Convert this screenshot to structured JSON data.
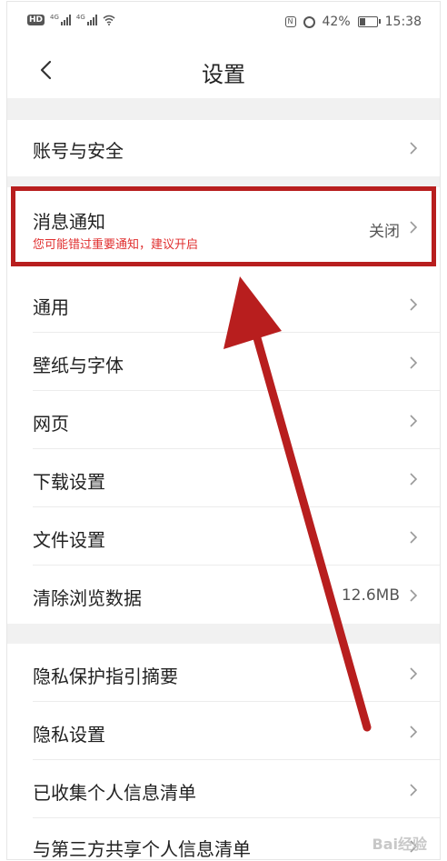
{
  "status_bar": {
    "network_badge": "HD",
    "sim1_tag": "4G",
    "sim2_tag": "4G",
    "battery_percent": 42,
    "battery_text": "42%",
    "time": "15:38",
    "icons": [
      "signal-icon",
      "wifi-icon",
      "nfc-icon",
      "alarm-icon",
      "battery-icon"
    ]
  },
  "header": {
    "back_icon": "chevron-left-icon",
    "title": "设置"
  },
  "settings": {
    "account": {
      "label": "账号与安全"
    },
    "notification": {
      "label": "消息通知",
      "subtitle": "您可能错过重要通知，建议开启",
      "value": "关闭"
    },
    "general": {
      "label": "通用"
    },
    "wallpaper_font": {
      "label": "壁纸与字体"
    },
    "webpage": {
      "label": "网页"
    },
    "download": {
      "label": "下载设置"
    },
    "file": {
      "label": "文件设置"
    },
    "clear_data": {
      "label": "清除浏览数据",
      "value": "12.6MB"
    },
    "privacy_guide": {
      "label": "隐私保护指引摘要"
    },
    "privacy_settings": {
      "label": "隐私设置"
    },
    "personal_info_list": {
      "label": "已收集个人信息清单"
    },
    "third_party_list": {
      "label": "与第三方共享个人信息清单"
    }
  },
  "annotation": {
    "color": "#b81e1e",
    "highlight": "消息通知",
    "arrow_icon": "arrow-up-left-icon"
  },
  "watermark": "Bai经验"
}
